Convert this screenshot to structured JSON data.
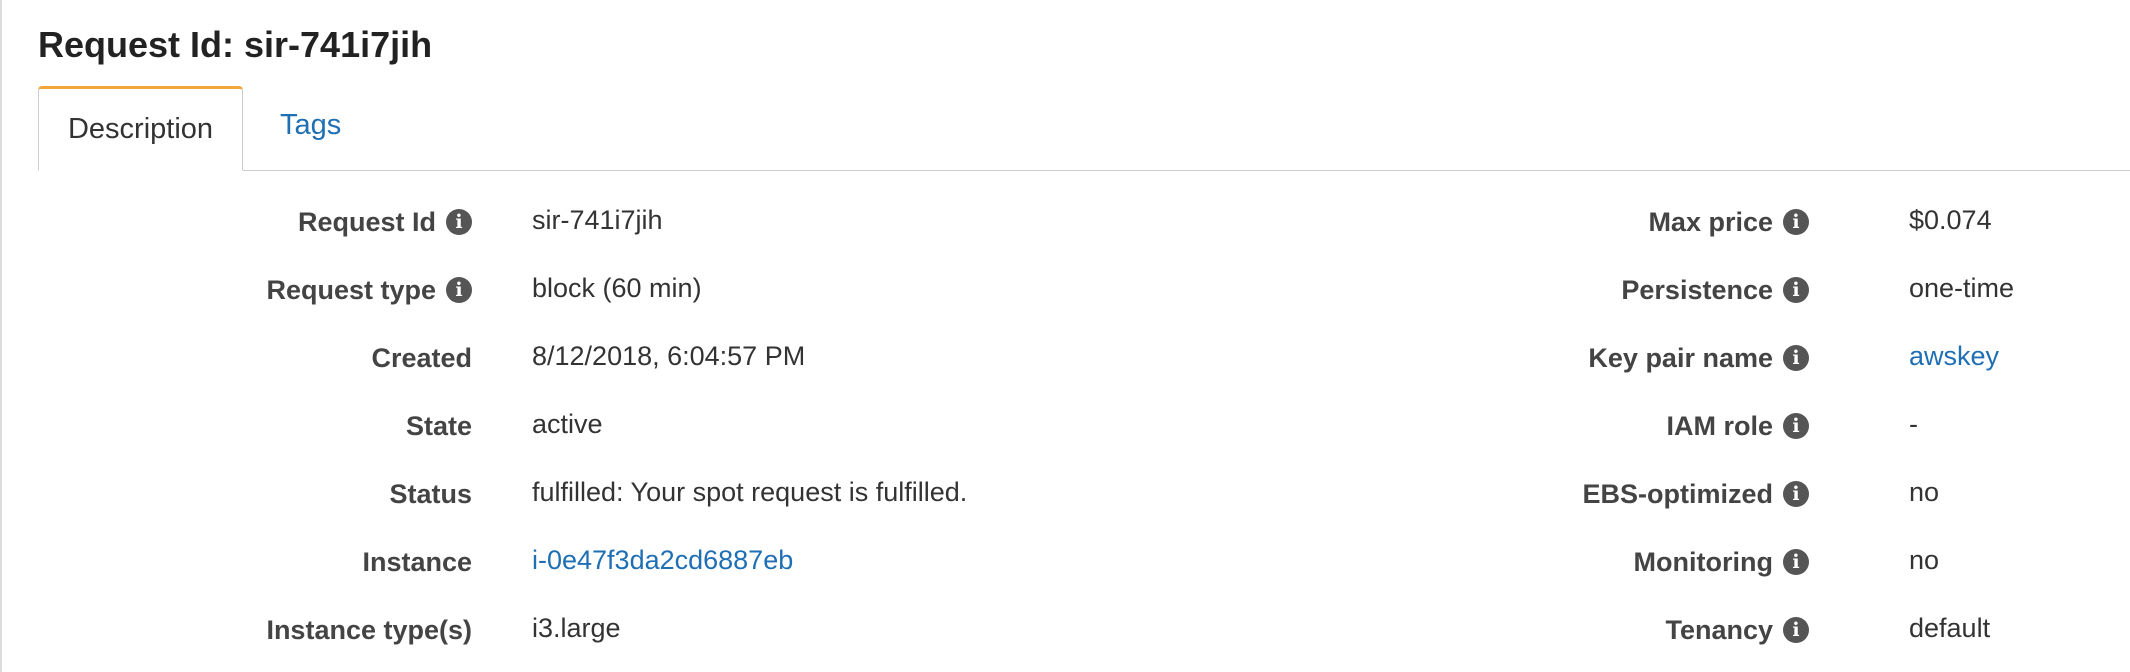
{
  "header": {
    "title": "Request Id: sir-741i7jih"
  },
  "tabs": [
    {
      "label": "Description",
      "active": true
    },
    {
      "label": "Tags",
      "active": false
    }
  ],
  "left_fields": [
    {
      "label": "Request Id",
      "value": "sir-741i7jih",
      "has_info": true,
      "is_link": false
    },
    {
      "label": "Request type",
      "value": "block (60 min)",
      "has_info": true,
      "is_link": false
    },
    {
      "label": "Created",
      "value": "8/12/2018, 6:04:57 PM",
      "has_info": false,
      "is_link": false
    },
    {
      "label": "State",
      "value": "active",
      "has_info": false,
      "is_link": false
    },
    {
      "label": "Status",
      "value": "fulfilled: Your spot request is fulfilled.",
      "has_info": false,
      "is_link": false
    },
    {
      "label": "Instance",
      "value": "i-0e47f3da2cd6887eb",
      "has_info": false,
      "is_link": true
    },
    {
      "label": "Instance type(s)",
      "value": "i3.large",
      "has_info": false,
      "is_link": false
    }
  ],
  "right_fields": [
    {
      "label": "Max price",
      "value": "$0.074",
      "has_info": true,
      "is_link": false
    },
    {
      "label": "Persistence",
      "value": "one-time",
      "has_info": true,
      "is_link": false
    },
    {
      "label": "Key pair name",
      "value": "awskey",
      "has_info": true,
      "is_link": true
    },
    {
      "label": "IAM role",
      "value": "-",
      "has_info": true,
      "is_link": false
    },
    {
      "label": "EBS-optimized",
      "value": "no",
      "has_info": true,
      "is_link": false
    },
    {
      "label": "Monitoring",
      "value": "no",
      "has_info": true,
      "is_link": false
    },
    {
      "label": "Tenancy",
      "value": "default",
      "has_info": true,
      "is_link": false
    }
  ],
  "icons": {
    "info": "info-icon"
  },
  "colors": {
    "active_tab_accent": "#f3a73b",
    "link": "#1f6fb5",
    "info_icon_bg": "#555555"
  }
}
